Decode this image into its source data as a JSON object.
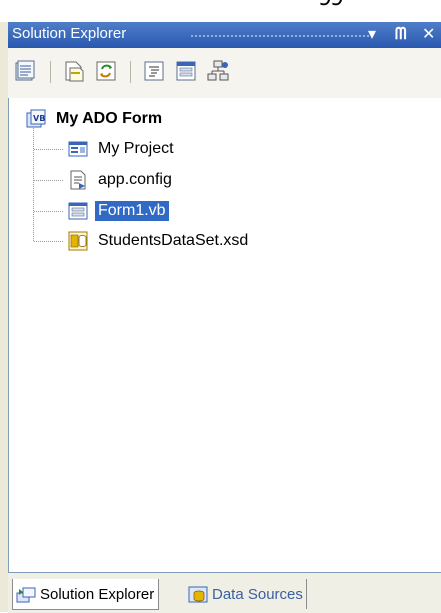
{
  "panel": {
    "title": "Solution Explorer",
    "buttons": {
      "dropdown": "▾",
      "pin": "ᗰ",
      "close": "✕"
    }
  },
  "toolbar": {
    "items": [
      {
        "name": "properties-icon"
      },
      {
        "name": "show-all-files-icon"
      },
      {
        "name": "refresh-icon"
      },
      {
        "name": "view-code-icon"
      },
      {
        "name": "view-designer-icon"
      },
      {
        "name": "class-diagram-icon"
      }
    ]
  },
  "tree": {
    "root": {
      "label": "My ADO Form",
      "icon": "vb-project-icon"
    },
    "children": [
      {
        "label": "My Project",
        "icon": "my-project-icon",
        "selected": false
      },
      {
        "label": "app.config",
        "icon": "config-file-icon",
        "selected": false
      },
      {
        "label": "Form1.vb",
        "icon": "form-icon",
        "selected": true
      },
      {
        "label": "StudentsDataSet.xsd",
        "icon": "dataset-icon",
        "selected": false
      }
    ]
  },
  "tabs": [
    {
      "label": "Solution Explorer",
      "icon": "solution-explorer-icon",
      "active": true
    },
    {
      "label": "Data Sources",
      "icon": "data-sources-icon",
      "active": false
    }
  ],
  "colors": {
    "titlebar": "#2a58b0",
    "selection": "#316ac5",
    "inactive_tab_text": "#3a5fa0"
  }
}
